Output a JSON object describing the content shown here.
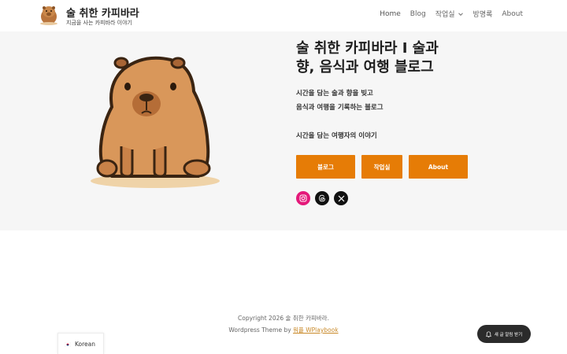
{
  "header": {
    "site_title": "술 취한 카피바라",
    "tagline": "지금을 사는 카피바라 이야기",
    "nav": [
      {
        "label": "Home"
      },
      {
        "label": "Blog"
      },
      {
        "label": "작업실"
      },
      {
        "label": "방명록"
      },
      {
        "label": "About"
      }
    ]
  },
  "hero": {
    "title": "술 취한 카피바라 I 술과 향, 음식과 여행 블로그",
    "lines": [
      "시간을 담는 술과 향을 빚고",
      "음식과 여행을 기록하는 블로그",
      "시간을 담는 여행자의 이야기"
    ],
    "buttons": [
      {
        "label": "블로그"
      },
      {
        "label": "작업실"
      },
      {
        "label": "About"
      }
    ],
    "accent_color": "#e67c06"
  },
  "social": [
    "instagram-icon",
    "threads-icon",
    "x-icon"
  ],
  "footer": {
    "copyright": "Copyright 2026 술 취한 카피바라.",
    "theme_prefix": "Wordpress Theme by ",
    "theme_link": "워플 WPlaybook"
  },
  "language": {
    "label": "Korean"
  },
  "alert_button": {
    "label": "새 글 알림 받기"
  }
}
